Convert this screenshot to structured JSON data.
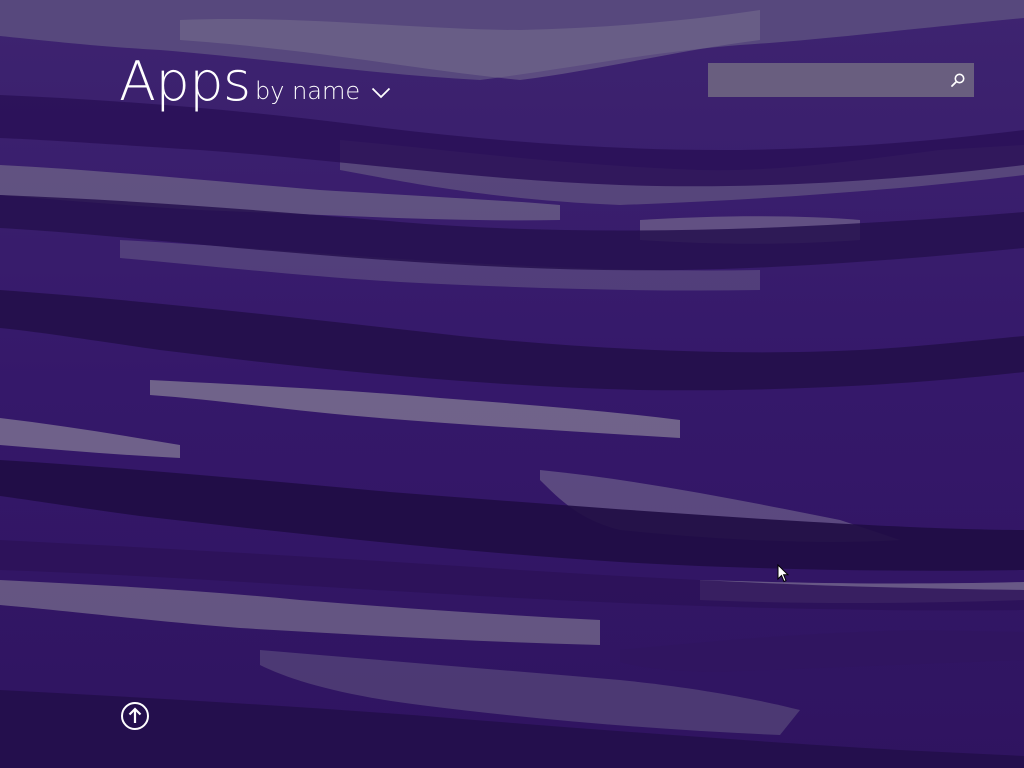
{
  "header": {
    "title": "Apps",
    "sort_label": "by name",
    "sort_icon": "chevron-down-icon"
  },
  "search": {
    "placeholder": "",
    "value": "",
    "icon": "search-icon"
  },
  "footer": {
    "up_button_icon": "arrow-up-circle-icon"
  },
  "colors": {
    "background": "#3a1d6e",
    "text": "#ffffff",
    "search_box": "#767084"
  }
}
